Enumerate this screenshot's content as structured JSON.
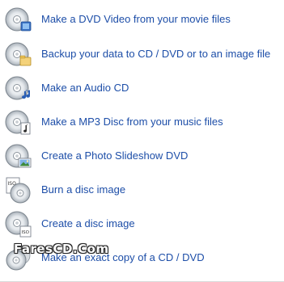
{
  "tasks": [
    {
      "label": "Make a DVD Video from your movie files",
      "icon": "dvd-video-icon"
    },
    {
      "label": "Backup your data to CD / DVD or to an image file",
      "icon": "data-disc-icon"
    },
    {
      "label": "Make an Audio CD",
      "icon": "audio-cd-icon"
    },
    {
      "label": "Make a MP3 Disc from your music files",
      "icon": "mp3-disc-icon"
    },
    {
      "label": "Create a Photo Slideshow DVD",
      "icon": "photo-slideshow-icon"
    },
    {
      "label": "Burn a disc image",
      "icon": "burn-image-icon"
    },
    {
      "label": "Create a disc image",
      "icon": "create-image-icon"
    },
    {
      "label": "Make an exact copy of a CD / DVD",
      "icon": "copy-disc-icon"
    }
  ],
  "watermark": "FaresCD.Com",
  "colors": {
    "link": "#1d4ea8",
    "background": "#ffffff"
  }
}
